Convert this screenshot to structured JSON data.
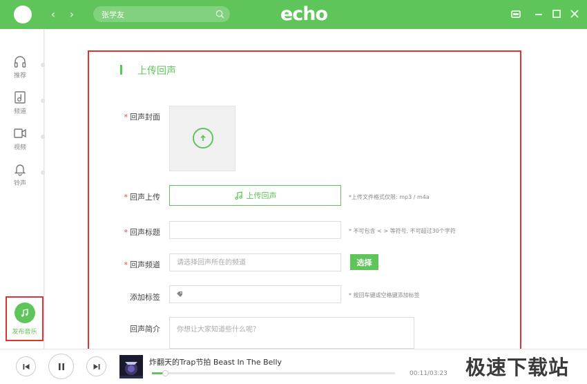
{
  "app": {
    "logo": "echo",
    "accent": "#5fc55a",
    "highlight_border": "#dd3333"
  },
  "header": {
    "back_icon": "‹",
    "forward_icon": "›",
    "search_value": "张学友"
  },
  "sidebar": {
    "items": [
      {
        "label": "推荐",
        "icon": "headphones-icon"
      },
      {
        "label": "频道",
        "icon": "music-album-icon"
      },
      {
        "label": "视频",
        "icon": "video-camera-icon"
      },
      {
        "label": "铃声",
        "icon": "bell-icon"
      }
    ],
    "publish_label": "发布音乐"
  },
  "form": {
    "title": "上传回声",
    "required_mark": "*",
    "cover_label": "回声封面",
    "upload_label": "回声上传",
    "upload_button": "上传回声",
    "upload_hint": "*上传文件格式仅限: mp3 / m4a",
    "title_label": "回声标题",
    "title_hint": "* 不可包含 < > 等符号, 不可超过30个字符",
    "channel_label": "回声频道",
    "channel_placeholder": "请选择回声所在的频道",
    "choose_button": "选择",
    "tags_label": "添加标签",
    "tags_hint": "* 按回车键或空格键添加标签",
    "intro_label": "回声简介",
    "intro_placeholder": "你想让大家知道些什么呢？"
  },
  "player": {
    "track": "炸翻天的Trap节拍 Beast In The Belly",
    "time": "00:11/03:23",
    "progress": 0.054
  },
  "watermark": "极速下载站"
}
